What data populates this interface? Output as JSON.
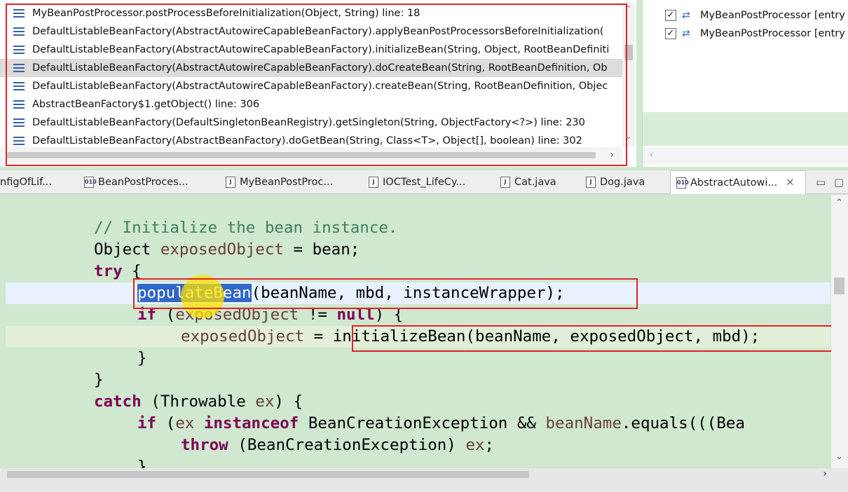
{
  "stack_frames": [
    "MyBeanPostProcessor.postProcessBeforeInitialization(Object, String) line: 18",
    "DefaultListableBeanFactory(AbstractAutowireCapableBeanFactory).applyBeanPostProcessorsBeforeInitialization(",
    "DefaultListableBeanFactory(AbstractAutowireCapableBeanFactory).initializeBean(String, Object, RootBeanDefiniti",
    "DefaultListableBeanFactory(AbstractAutowireCapableBeanFactory).doCreateBean(String, RootBeanDefinition, Ob",
    "DefaultListableBeanFactory(AbstractAutowireCapableBeanFactory).createBean(String, RootBeanDefinition, Objec",
    "AbstractBeanFactory$1.getObject() line: 306",
    "DefaultListableBeanFactory(DefaultSingletonBeanRegistry).getSingleton(String, ObjectFactory<?>) line: 230",
    "DefaultListableBeanFactory(AbstractBeanFactory).doGetBean(String, Class<T>, Object[], boolean) line: 302"
  ],
  "selected_frame_index": 3,
  "breakpoints": [
    {
      "label": "MyBeanPostProcessor [entry",
      "checked": true
    },
    {
      "label": "MyBeanPostProcessor [entry",
      "checked": true
    }
  ],
  "tabs": [
    {
      "label": "nfigOfLif...",
      "icon": "class-file-icon"
    },
    {
      "label": "BeanPostProces...",
      "icon": "class-file-icon"
    },
    {
      "label": "MyBeanPostProc...",
      "icon": "java-file-icon"
    },
    {
      "label": "IOCTest_LifeCy...",
      "icon": "java-file-icon"
    },
    {
      "label": "Cat.java",
      "icon": "java-file-icon"
    },
    {
      "label": "Dog.java",
      "icon": "java-file-icon"
    },
    {
      "label": "AbstractAutowi...",
      "icon": "class-file-icon",
      "active": true
    }
  ],
  "glyphs": {
    "check": "✓",
    "close": "✕",
    "minimize": "▭",
    "maximize": "▢",
    "up": "⌃",
    "down": "⌄",
    "left": "‹",
    "right": "›",
    "class_badge": "010",
    "java_badge": "J"
  },
  "code": {
    "comment": "// Initialize the bean instance.",
    "l2_type": "Object ",
    "l2_var": "exposedObject",
    "l2_rest": " = bean;",
    "l3_kw": "try",
    "l3_rest": " {",
    "l4_sel": "populateBean",
    "l4_rest": "(beanName, mbd, instanceWrapper);",
    "l5_kw": "if",
    "l5_a": " (",
    "l5_var": "exposedObject",
    "l5_b": " != ",
    "l5_null": "null",
    "l5_c": ") {",
    "l6_var": "exposedObject",
    "l6_rest": " = initializeBean(beanName, exposedObject, mbd);",
    "l7": "}",
    "l8": "}",
    "l9_kw": "catch",
    "l9_a": " (Throwable ",
    "l9_var": "ex",
    "l9_b": ") {",
    "l10_kw": "if",
    "l10_a": " (",
    "l10_var": "ex",
    "l10_kw2": " instanceof",
    "l10_b": " BeanCreationException && ",
    "l10_var2": "beanName",
    "l10_c": ".equals(((Bea",
    "l11_kw": "throw",
    "l11_a": " (BeanCreationException) ",
    "l11_var": "ex",
    "l11_b": ";",
    "l12": "}"
  },
  "colors": {
    "highlight_box": "#e0232b",
    "editor_bg": "#cfe8cf",
    "selection": "#2f66c8",
    "keyword": "#7f0055",
    "comment": "#3f7f5f"
  }
}
